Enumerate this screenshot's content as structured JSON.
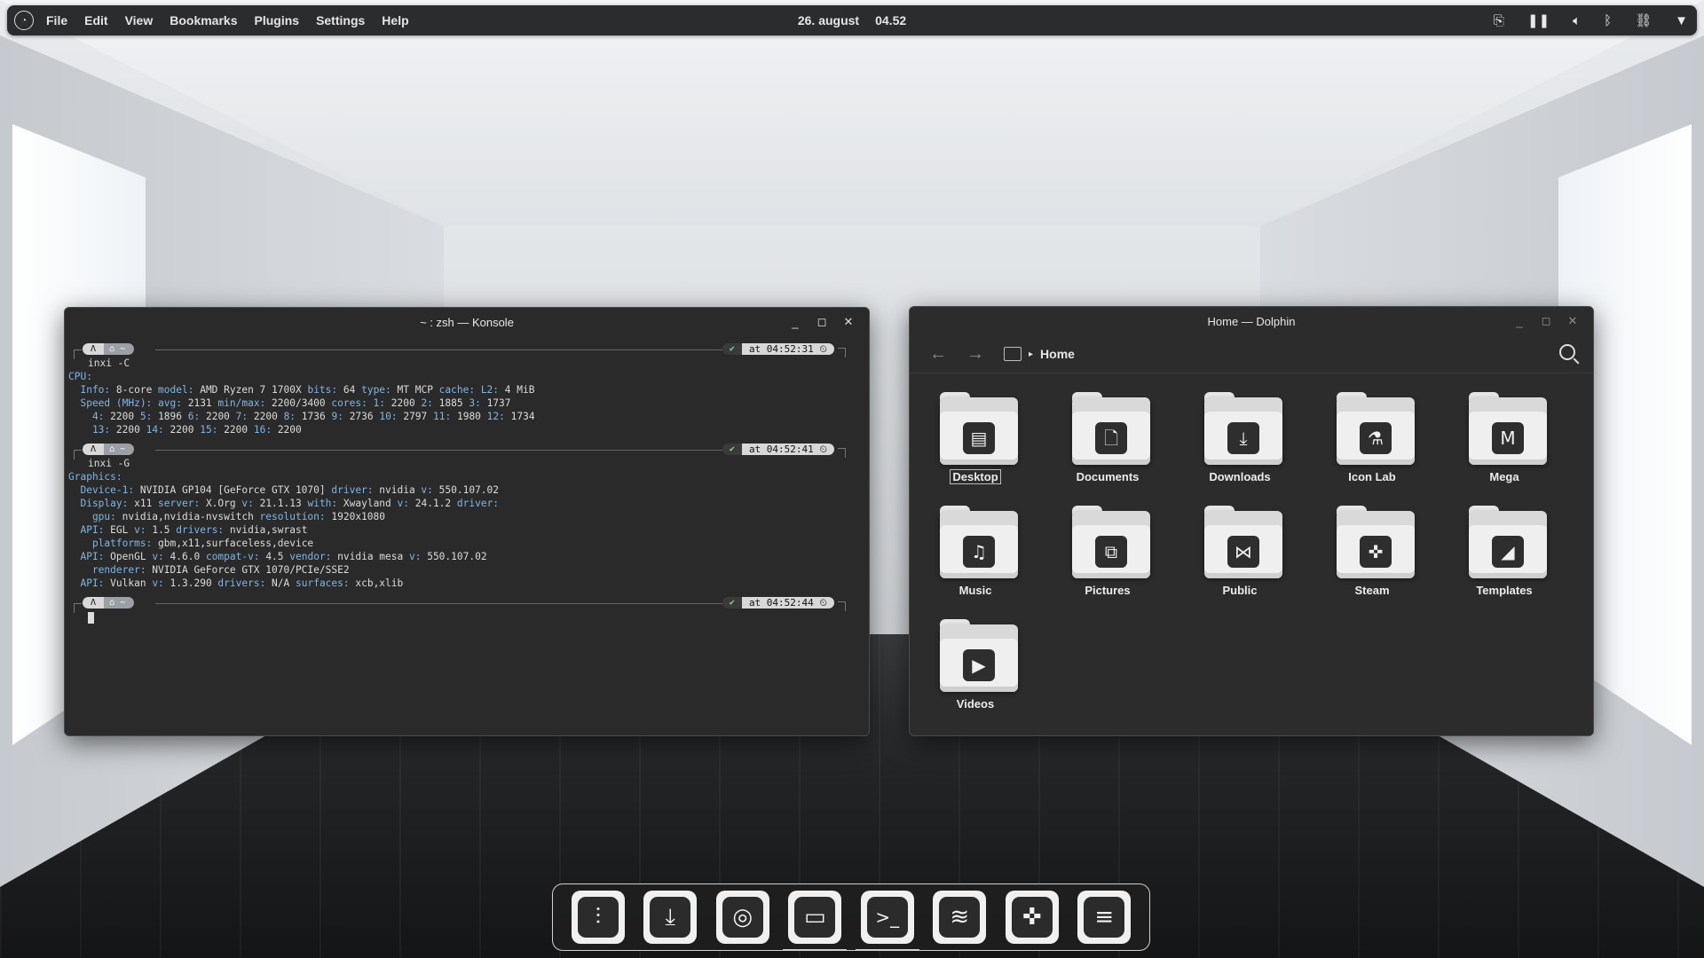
{
  "menubar": {
    "items": [
      "File",
      "Edit",
      "View",
      "Bookmarks",
      "Plugins",
      "Settings",
      "Help"
    ],
    "date": "26. august",
    "time": "04.52",
    "tray_icons": [
      "clipboard-icon",
      "media-pause-icon",
      "volume-icon",
      "bluetooth-icon",
      "network-icon",
      "expand-arrow-icon"
    ]
  },
  "konsole": {
    "title": "~ : zsh — Konsole",
    "prompt_icon": "Λ",
    "prompt_dir": "⌂ ~",
    "blocks": [
      {
        "time": "at 04:52:31",
        "command": "inxi -C",
        "output": [
          [
            {
              "t": "CPU:",
              "k": true
            }
          ],
          [
            {
              "t": "  Info: ",
              "k": true
            },
            {
              "t": "8-core "
            },
            {
              "t": "model: ",
              "k": true
            },
            {
              "t": "AMD Ryzen 7 1700X "
            },
            {
              "t": "bits: ",
              "k": true
            },
            {
              "t": "64 "
            },
            {
              "t": "type: ",
              "k": true
            },
            {
              "t": "MT MCP "
            },
            {
              "t": "cache: L2: ",
              "k": true
            },
            {
              "t": "4 MiB"
            }
          ],
          [
            {
              "t": "  Speed (MHz): avg: ",
              "k": true
            },
            {
              "t": "2131 "
            },
            {
              "t": "min/max: ",
              "k": true
            },
            {
              "t": "2200/3400 "
            },
            {
              "t": "cores: 1: ",
              "k": true
            },
            {
              "t": "2200 "
            },
            {
              "t": "2: ",
              "k": true
            },
            {
              "t": "1885 "
            },
            {
              "t": "3: ",
              "k": true
            },
            {
              "t": "1737"
            }
          ],
          [
            {
              "t": "    4: ",
              "k": true
            },
            {
              "t": "2200 "
            },
            {
              "t": "5: ",
              "k": true
            },
            {
              "t": "1896 "
            },
            {
              "t": "6: ",
              "k": true
            },
            {
              "t": "2200 "
            },
            {
              "t": "7: ",
              "k": true
            },
            {
              "t": "2200 "
            },
            {
              "t": "8: ",
              "k": true
            },
            {
              "t": "1736 "
            },
            {
              "t": "9: ",
              "k": true
            },
            {
              "t": "2736 "
            },
            {
              "t": "10: ",
              "k": true
            },
            {
              "t": "2797 "
            },
            {
              "t": "11: ",
              "k": true
            },
            {
              "t": "1980 "
            },
            {
              "t": "12: ",
              "k": true
            },
            {
              "t": "1734"
            }
          ],
          [
            {
              "t": "    13: ",
              "k": true
            },
            {
              "t": "2200 "
            },
            {
              "t": "14: ",
              "k": true
            },
            {
              "t": "2200 "
            },
            {
              "t": "15: ",
              "k": true
            },
            {
              "t": "2200 "
            },
            {
              "t": "16: ",
              "k": true
            },
            {
              "t": "2200"
            }
          ]
        ]
      },
      {
        "time": "at 04:52:41",
        "command": "inxi -G",
        "output": [
          [
            {
              "t": "Graphics:",
              "k": true
            }
          ],
          [
            {
              "t": "  Device-1: ",
              "k": true
            },
            {
              "t": "NVIDIA GP104 [GeForce GTX 1070] "
            },
            {
              "t": "driver: ",
              "k": true
            },
            {
              "t": "nvidia "
            },
            {
              "t": "v: ",
              "k": true
            },
            {
              "t": "550.107.02"
            }
          ],
          [
            {
              "t": "  Display: ",
              "k": true
            },
            {
              "t": "x11 "
            },
            {
              "t": "server: ",
              "k": true
            },
            {
              "t": "X.Org "
            },
            {
              "t": "v: ",
              "k": true
            },
            {
              "t": "21.1.13 "
            },
            {
              "t": "with: ",
              "k": true
            },
            {
              "t": "Xwayland "
            },
            {
              "t": "v: ",
              "k": true
            },
            {
              "t": "24.1.2 "
            },
            {
              "t": "driver:",
              "k": true
            }
          ],
          [
            {
              "t": "    gpu: ",
              "k": true
            },
            {
              "t": "nvidia,nvidia-nvswitch "
            },
            {
              "t": "resolution: ",
              "k": true
            },
            {
              "t": "1920x1080"
            }
          ],
          [
            {
              "t": "  API: ",
              "k": true
            },
            {
              "t": "EGL "
            },
            {
              "t": "v: ",
              "k": true
            },
            {
              "t": "1.5 "
            },
            {
              "t": "drivers: ",
              "k": true
            },
            {
              "t": "nvidia,swrast"
            }
          ],
          [
            {
              "t": "    platforms: ",
              "k": true
            },
            {
              "t": "gbm,x11,surfaceless,device"
            }
          ],
          [
            {
              "t": "  API: ",
              "k": true
            },
            {
              "t": "OpenGL "
            },
            {
              "t": "v: ",
              "k": true
            },
            {
              "t": "4.6.0 "
            },
            {
              "t": "compat-v: ",
              "k": true
            },
            {
              "t": "4.5 "
            },
            {
              "t": "vendor: ",
              "k": true
            },
            {
              "t": "nvidia mesa "
            },
            {
              "t": "v: ",
              "k": true
            },
            {
              "t": "550.107.02"
            }
          ],
          [
            {
              "t": "    renderer: ",
              "k": true
            },
            {
              "t": "NVIDIA GeForce GTX 1070/PCIe/SSE2"
            }
          ],
          [
            {
              "t": "  API: ",
              "k": true
            },
            {
              "t": "Vulkan "
            },
            {
              "t": "v: ",
              "k": true
            },
            {
              "t": "1.3.290 "
            },
            {
              "t": "drivers: ",
              "k": true
            },
            {
              "t": "N/A "
            },
            {
              "t": "surfaces: ",
              "k": true
            },
            {
              "t": "xcb,xlib"
            }
          ]
        ]
      },
      {
        "time": "at 04:52:44",
        "command": "",
        "output": []
      }
    ]
  },
  "dolphin": {
    "title": "Home — Dolphin",
    "breadcrumb": "Home",
    "items": [
      {
        "label": "Desktop",
        "icon": "desktop-icon",
        "glyph": "▤",
        "selected": true
      },
      {
        "label": "Documents",
        "icon": "document-icon",
        "glyph": "🗋"
      },
      {
        "label": "Downloads",
        "icon": "download-icon",
        "glyph": "⤓"
      },
      {
        "label": "Icon Lab",
        "icon": "flask-icon",
        "glyph": "⚗"
      },
      {
        "label": "Mega",
        "icon": "mega-icon",
        "glyph": "M"
      },
      {
        "label": "Music",
        "icon": "music-note-icon",
        "glyph": "♫"
      },
      {
        "label": "Pictures",
        "icon": "picture-icon",
        "glyph": "⧉"
      },
      {
        "label": "Public",
        "icon": "share-icon",
        "glyph": "⋈"
      },
      {
        "label": "Steam",
        "icon": "gamepad-icon",
        "glyph": "✜"
      },
      {
        "label": "Templates",
        "icon": "template-icon",
        "glyph": "◢"
      },
      {
        "label": "Videos",
        "icon": "play-icon",
        "glyph": "▶"
      }
    ]
  },
  "dock": {
    "apps": [
      {
        "name": "mixer-icon",
        "glyph": "⫶",
        "active": false
      },
      {
        "name": "software-store-icon",
        "glyph": "⤓",
        "active": false
      },
      {
        "name": "chrome-icon",
        "glyph": "◎",
        "active": false
      },
      {
        "name": "files-icon",
        "glyph": "▭",
        "active": true
      },
      {
        "name": "terminal-icon",
        "glyph": ">_",
        "active": true
      },
      {
        "name": "spotify-icon",
        "glyph": "≋",
        "active": false
      },
      {
        "name": "game-controller-icon",
        "glyph": "✜",
        "active": false
      },
      {
        "name": "layers-icon",
        "glyph": "≡",
        "active": false
      }
    ]
  }
}
